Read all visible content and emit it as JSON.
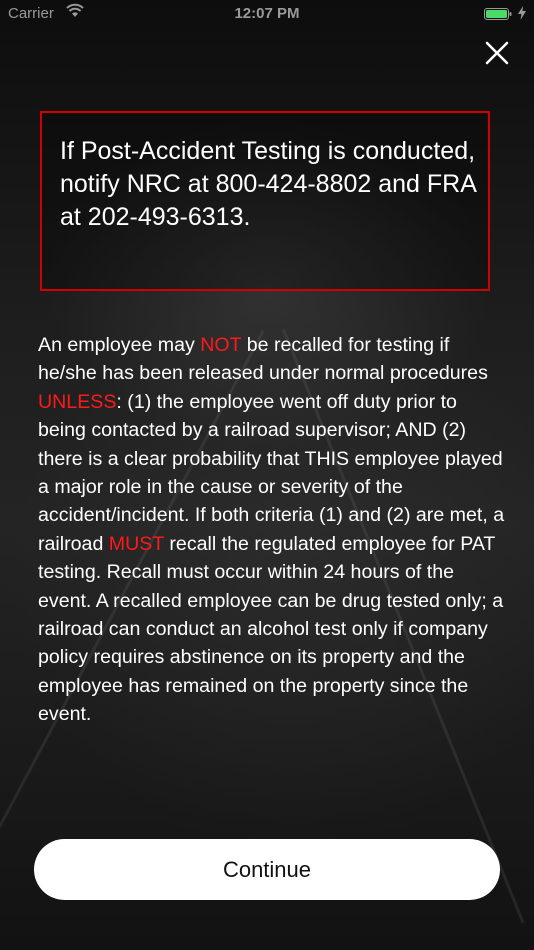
{
  "status_bar": {
    "carrier": "Carrier",
    "time": "12:07 PM",
    "battery_color": "#4cd964"
  },
  "icons": {
    "close": "close-icon",
    "wifi": "wifi-icon",
    "battery": "battery-icon",
    "charging": "charging-bolt-icon"
  },
  "notice": {
    "text": "If Post-Accident Testing is conducted, notify NRC at 800-424-8802 and FRA at 202-493-6313.",
    "border_color": "#d40000"
  },
  "body": {
    "part1": "An employee may ",
    "not": "NOT",
    "part2": " be recalled for testing if he/she has been released under normal procedures ",
    "unless": "UNLESS",
    "part3": ": (1) the employee went off duty prior to being contacted by a railroad supervisor; AND (2) there is a clear probability that THIS employee played a major role in the cause or severity of the accident/incident. If both criteria (1) and (2) are met, a railroad ",
    "must": "MUST",
    "part4": " recall the regulated employee for PAT testing. Recall must occur within 24 hours of the event. A recalled employee can be drug tested only; a railroad can conduct an alcohol test only if company policy requires abstinence on its property and the employee has remained on the property since the event.",
    "emphasis_color": "#ff1a1a"
  },
  "continue_label": "Continue"
}
